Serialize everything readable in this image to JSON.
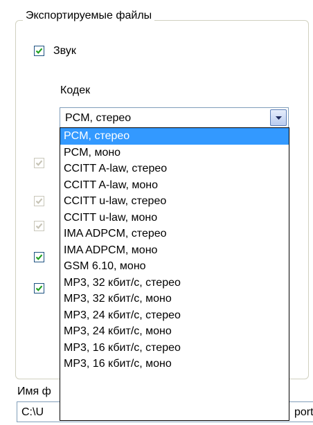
{
  "group": {
    "title": "Экспортируемые файлы"
  },
  "sound": {
    "label": "Звук",
    "checked": true
  },
  "codec": {
    "label": "Кодек",
    "selected": "PCM, стерео",
    "options": [
      "PCM, стерео",
      "PCM, моно",
      "CCITT A-law, стерео",
      "CCITT A-law, моно",
      "CCITT u-law, стерео",
      "CCITT u-law, моно",
      "IMA ADPCM, стерео",
      "IMA ADPCM, моно",
      "GSM 6.10, моно",
      "MP3, 32 кбит/с, стерео",
      "MP3, 32 кбит/с, моно",
      "MP3, 24 кбит/с, стерео",
      "MP3, 24 кбит/с, моно",
      "MP3, 16 кбит/с, стерео",
      "MP3, 16 кбит/с, моно"
    ],
    "highlighted_index": 0
  },
  "hidden_checkboxes": [
    {
      "checked": true,
      "enabled": false
    },
    {
      "checked": true,
      "enabled": false
    },
    {
      "checked": true,
      "enabled": false
    },
    {
      "checked": true,
      "enabled": true
    },
    {
      "checked": true,
      "enabled": true
    }
  ],
  "filename": {
    "label_visible": "Имя ф",
    "value_left": "C:\\U",
    "value_right": "port"
  },
  "colors": {
    "check": "#21a121",
    "check_disabled": "#c6c3b5",
    "highlight": "#3399ff"
  }
}
